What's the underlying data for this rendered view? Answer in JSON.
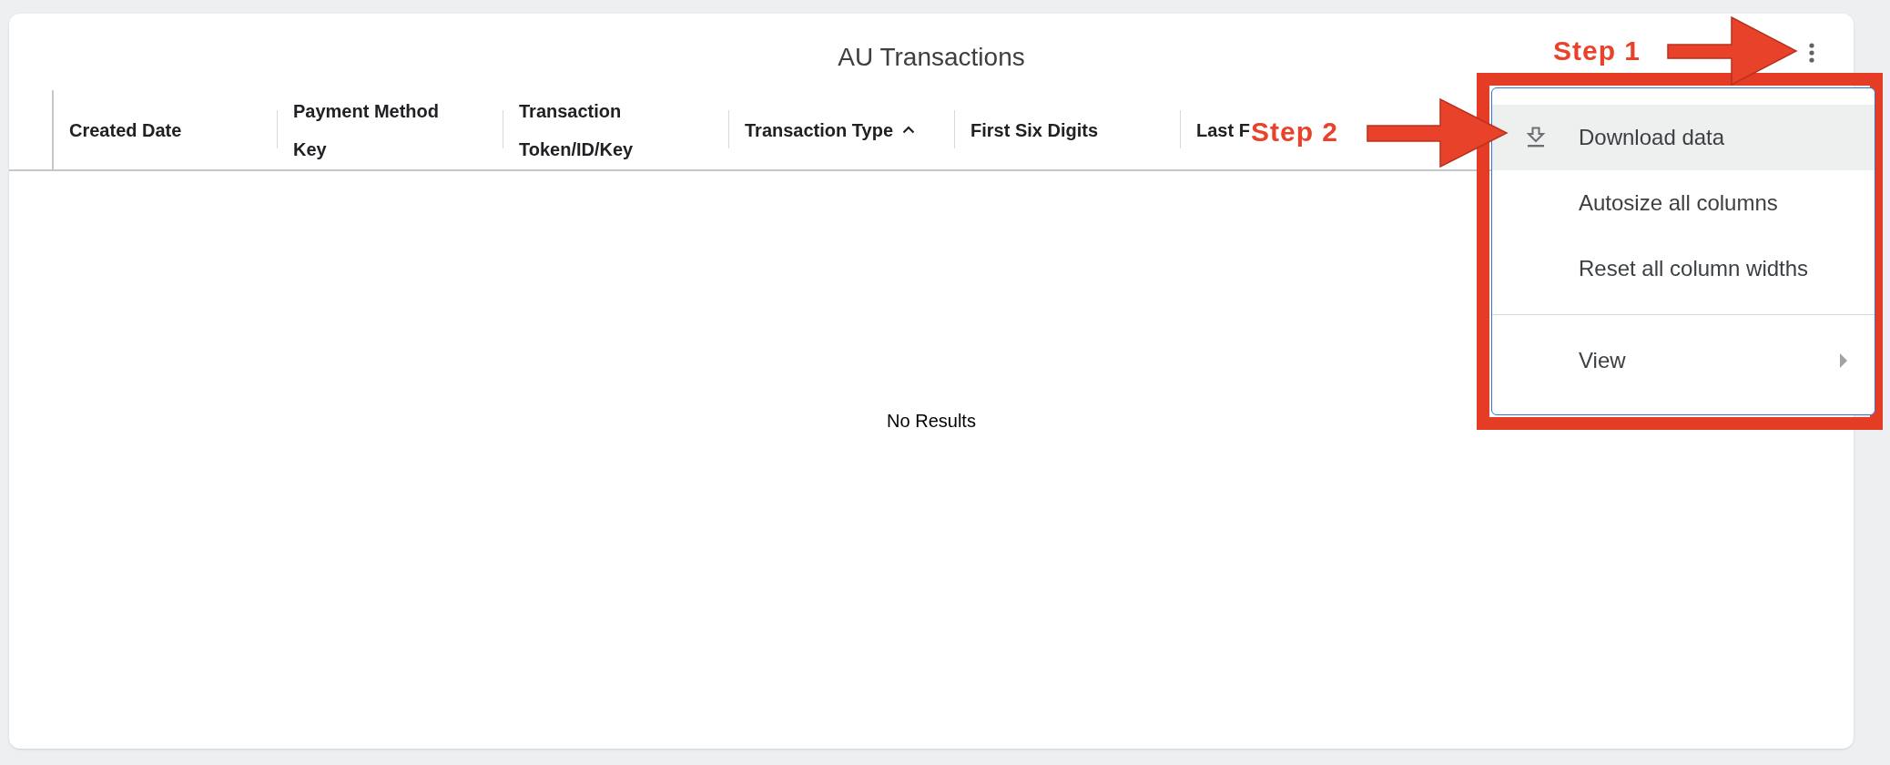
{
  "title": "AU Transactions",
  "columns": [
    {
      "label": "Created Date",
      "sorted": false
    },
    {
      "label": "Payment Method Key",
      "sorted": false
    },
    {
      "label": "Transaction Token/ID/Key",
      "sorted": false
    },
    {
      "label": "Transaction Type",
      "sorted": true
    },
    {
      "label": "First Six Digits",
      "sorted": false
    },
    {
      "label": "Last F",
      "sorted": false
    }
  ],
  "empty_message": "No Results",
  "menu": {
    "items": [
      {
        "kind": "download",
        "label": "Download data",
        "selected": true
      },
      {
        "kind": "action",
        "label": "Autosize all columns",
        "selected": false
      },
      {
        "kind": "action",
        "label": "Reset all column widths",
        "selected": false
      },
      {
        "kind": "separator"
      },
      {
        "kind": "submenu",
        "label": "View",
        "selected": false
      }
    ]
  },
  "annotations": [
    {
      "text": "Step 1"
    },
    {
      "text": "Step 2"
    }
  ]
}
